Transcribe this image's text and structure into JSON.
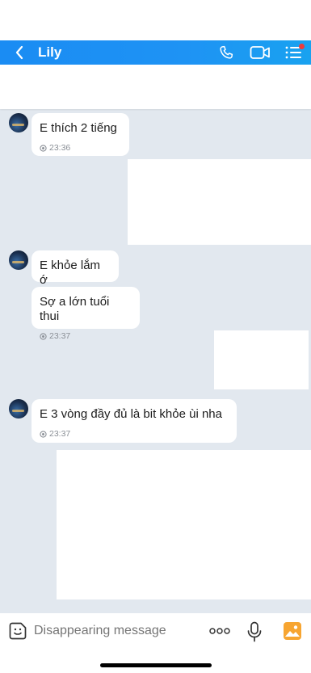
{
  "header": {
    "title": "Lily"
  },
  "messages": [
    {
      "text": "E thích 2 tiếng",
      "time": "23:36"
    },
    {
      "text": "E khỏe lắm ớ"
    },
    {
      "text": "Sợ a lớn tuổi thui",
      "time": "23:37"
    },
    {
      "text": "E 3 vòng đầy đủ là bit khỏe ùi nha",
      "time": "23:37"
    }
  ],
  "composer": {
    "placeholder": "Disappearing message"
  },
  "icons": {
    "back": "chevron-left-icon",
    "call": "phone-icon",
    "video": "video-camera-icon",
    "menu": "list-menu-icon",
    "sticker": "sticker-icon",
    "more": "more-dots-icon",
    "mic": "microphone-icon",
    "gallery": "image-gallery-icon"
  },
  "colors": {
    "header": "#1a8cf3",
    "background": "#e2e8ef",
    "notification_dot": "#ef3b3b",
    "gallery_icon": "#f7a531"
  }
}
